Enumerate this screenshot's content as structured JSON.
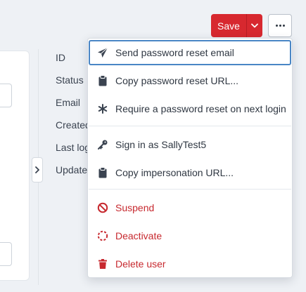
{
  "header": {
    "save_label": "Save"
  },
  "details": {
    "labels": [
      "ID",
      "Status",
      "Email",
      "Created",
      "Last login",
      "Updated"
    ]
  },
  "menu": {
    "items": [
      {
        "label": "Send password reset email",
        "icon": "paper-plane-icon"
      },
      {
        "label": "Copy password reset URL...",
        "icon": "clipboard-icon"
      },
      {
        "label": "Require a password reset on next login",
        "icon": "asterisk-icon"
      },
      {
        "label": "Sign in as SallyTest5",
        "icon": "key-icon"
      },
      {
        "label": "Copy impersonation URL...",
        "icon": "clipboard-icon"
      },
      {
        "label": "Suspend",
        "icon": "ban-icon"
      },
      {
        "label": "Deactivate",
        "icon": "dashed-circle-icon"
      },
      {
        "label": "Delete user",
        "icon": "trash-icon"
      }
    ]
  },
  "colors": {
    "primary_danger": "#d7282f",
    "danger_text": "#c7292f",
    "focus_ring": "#4a86c5",
    "background": "#eef1f5"
  }
}
